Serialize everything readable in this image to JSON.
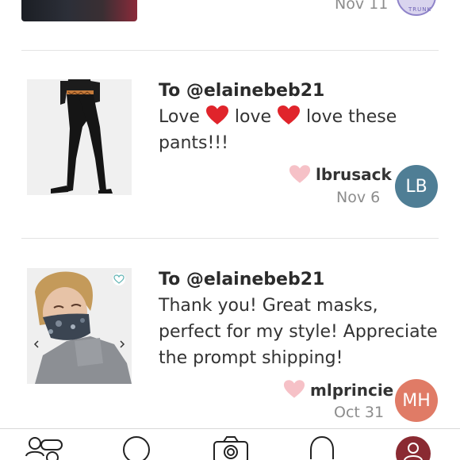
{
  "partial": {
    "date": "Nov 11",
    "avatar_text": "TRUNK"
  },
  "comments": [
    {
      "to": "To @elainebeb21",
      "msg_parts": [
        "Love",
        "love",
        "love these pants!!!"
      ],
      "username": "lbrusack",
      "date": "Nov 6",
      "avatar_initials": "LB",
      "avatar_color": "#4f7e95"
    },
    {
      "to": "To @elainebeb21",
      "message": "Thank you! Great masks, perfect for my style! Appreciate the prompt shipping!",
      "username": "mlprincie",
      "date": "Oct 31",
      "avatar_initials": "MH",
      "avatar_color": "#e07b66"
    }
  ],
  "colors": {
    "like_heart": "#f6c1c7",
    "red_heart_emoji": "#e0242b",
    "divider": "#e3e3e3",
    "profile_avatar": "#8a2a32"
  },
  "bottom_nav": [
    "people-icon",
    "circle-icon",
    "camera-icon",
    "bell-icon",
    "profile-icon"
  ]
}
